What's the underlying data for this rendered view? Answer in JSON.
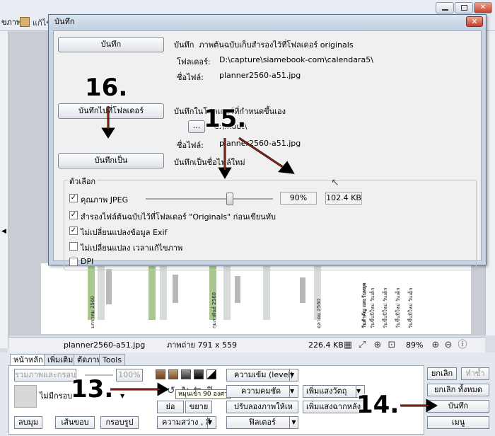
{
  "app": {
    "tab_fragment": "ขภาพ",
    "tab2_fragment": "แก้ไข"
  },
  "dialog": {
    "title": "บันทึก",
    "save_button": "บันทึก",
    "save_desc_prefix": "บันทึก",
    "save_desc": "ภาพต้นฉบับเก็บสำรองไว้ที่โฟลเดอร์ originals",
    "folder_label": "โฟลเดอร์:",
    "folder_value": "D:\\capture\\siamebook-com\\calendara5\\",
    "filename_label": "ชื่อไฟล์:",
    "filename_value": "planner2560-a51.jpg",
    "save_to_folder_button": "บันทึกไปที่โฟลเดอร์",
    "save_to_folder_desc": "บันทึกในโฟลเดอร์ที่กำหนดขึ้นเอง",
    "browse_button": "...",
    "folder2_value": "C:\\...out\\",
    "filename2_label": "ชื่อไฟล์:",
    "filename2_value": "planner2560-a51.jpg",
    "save_as_button": "บันทึกเป็น",
    "save_as_desc": "บันทึกเป็นชื่อไฟล์ใหม่",
    "options_title": "ตัวเลือก",
    "jpeg_quality_label": "คุณภาพ JPEG",
    "jpeg_quality_percent": "90%",
    "file_size": "102.4 KB",
    "opt_backup_label": "สำรองไฟล์ต้นฉบับไว้ที่โฟลเดอร์ \"Originals\" ก่อนเขียนทับ",
    "opt_exif_label": "ไม่เปลี่ยนแปลงข้อมูล Exif",
    "opt_time_label": "ไม่เปลี่ยนแปลง เวลาแก้ไขภาพ",
    "opt_dpi_label": "DPI",
    "checks": {
      "jpeg": true,
      "backup": true,
      "exif": true,
      "time": false,
      "dpi": false
    }
  },
  "status": {
    "filename": "planner2560-a51.jpg",
    "image_info": "ภาพถ่าย 791 x 559",
    "size": "226.4 KB",
    "zoom": "89%"
  },
  "tabs": [
    "หน้าหลัก",
    "เพิ่มเติม",
    "ตัดภาพ",
    "Tools"
  ],
  "panel": {
    "frame_button": "รวมภาพและกรอบ",
    "zoom_value": "100%",
    "no_frame": "ไม่มีกรอบ",
    "round_corner": "ลบมุม",
    "border": "เส้นขอบ",
    "frame_image": "กรอบรูป",
    "levels": "ความเข้ม (level)",
    "sharpness": "ความคมชัด",
    "auto_adjust": "ปรับลองภาพให้เหมือนเ",
    "brightness": "ความสว่าง , สี",
    "filter": "ฟิลเตอร์",
    "resize": "ย่อ",
    "size": "ขยาย",
    "add_object": "เพิ่มแสงวัตถุ",
    "add_bg_light": "เพิ่มแสงฉากหลัง",
    "rotate_tooltip": "หมุนเข้า 90 องศา",
    "cancel": "ยกเลิก",
    "redo": "ทำซ้ำ",
    "cancel_all": "ยกเลิก ทั้งหมด",
    "save": "บันทึก",
    "menu": "เมนู"
  },
  "annotations": {
    "n13": "13.",
    "n14": "14.",
    "n15": "15.",
    "n16": "16."
  },
  "calendar_text": [
    "มกราคม 2560",
    "กุมภาพันธ์ 2560",
    "ตุลาคม 2560",
    "วันสำคัญ และวันหยุด",
    "วันขึ้นปีใหม่ วันเด็ก"
  ]
}
